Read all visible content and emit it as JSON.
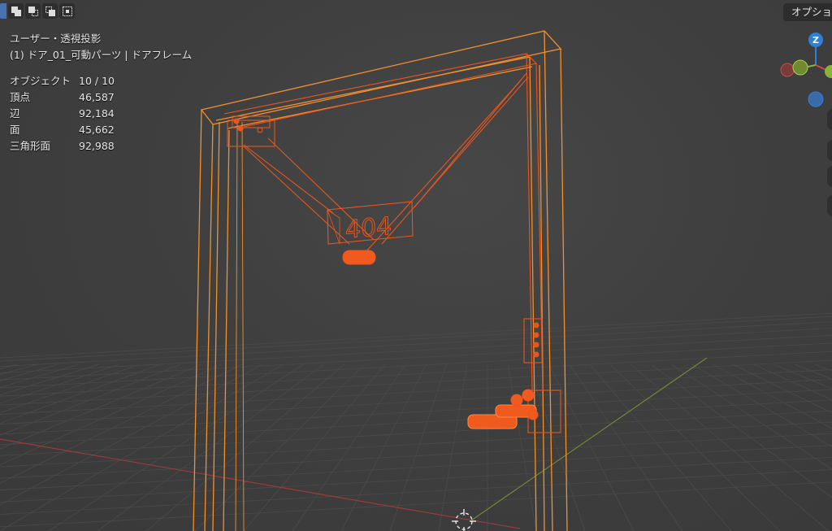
{
  "toolbar": {
    "buttons": [
      {
        "name": "select-box-icon"
      },
      {
        "name": "select-extend-icon"
      },
      {
        "name": "select-subtract-icon"
      },
      {
        "name": "select-invert-icon"
      },
      {
        "name": "select-intersect-icon"
      }
    ]
  },
  "overlay": {
    "view_title": "ユーザー・透視投影",
    "object_name": "(1) ドア_01_可動パーツ | ドアフレーム",
    "stats": [
      {
        "label": "オブジェクト",
        "value": "10 / 10"
      },
      {
        "label": "頂点",
        "value": "46,587"
      },
      {
        "label": "辺",
        "value": "92,184"
      },
      {
        "label": "面",
        "value": "45,662"
      },
      {
        "label": "三角形面",
        "value": "92,988"
      }
    ]
  },
  "header": {
    "options_label": "オプショ"
  },
  "gizmo": {
    "z_label": "Z",
    "colors": {
      "z": "#2f7fd6",
      "x": "#c94a4a",
      "y": "#8bb33a",
      "neg_z": "#3a6aa8"
    }
  },
  "scene": {
    "colors": {
      "background": "#3d3d3d",
      "grid": "#4a4a4a",
      "x_axis": "#9a3b3b",
      "y_axis": "#6f8a32",
      "frame": "#f2902e",
      "selected": "#e8561e",
      "sign_label": "404"
    }
  }
}
